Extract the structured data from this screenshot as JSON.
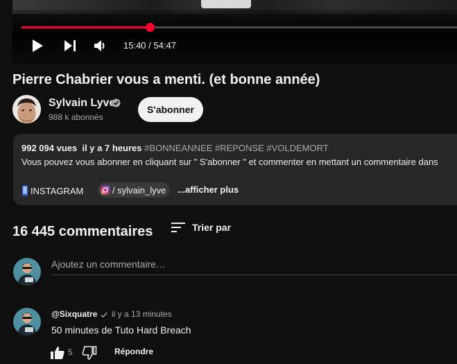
{
  "player": {
    "time_display": "15:40 / 54:47",
    "progress_fraction": 0.286,
    "play_icon": "play-icon",
    "next_icon": "next-icon",
    "volume_icon": "volume-icon",
    "accent": "#ff0033"
  },
  "video": {
    "title": "Pierre Chabrier vous a menti. (et bonne année)"
  },
  "channel": {
    "name": "Sylvain Lyve",
    "subscribers": "988 k abonnés",
    "subscribe_label": "S'abonner"
  },
  "description": {
    "views": "992 094 vues",
    "age": "il y a 7 heures",
    "hashtags": "#BONNEANNEE #REPONSE #VOLDEMORT",
    "text": "Vous pouvez vous abonner en cliquant sur \" S'abonner \" et commenter en mettant un commentaire dans",
    "instagram_label": "INSTAGRAM",
    "instagram_handle": "/ sylvain_lyve",
    "show_more": "...afficher plus"
  },
  "comments": {
    "count_label": "16 445 commentaires",
    "sort_label": "Trier par",
    "input_placeholder": "Ajoutez un commentaire…",
    "items": [
      {
        "author": "@Sixquatre",
        "time": "il y a 13 minutes",
        "text": "50 minutes de Tuto Hard Breach",
        "likes": "5",
        "reply_label": "Répondre"
      }
    ]
  }
}
